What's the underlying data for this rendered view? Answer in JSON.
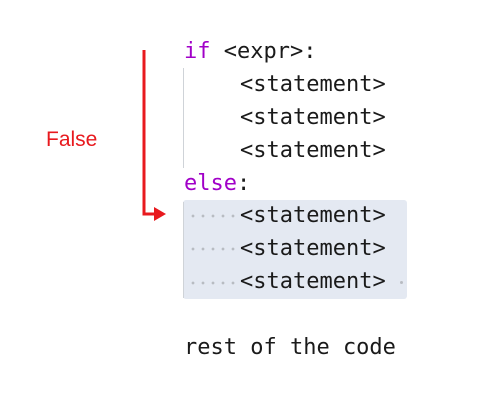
{
  "flow": {
    "condition_label": "False",
    "arrow_color": "#e8191e"
  },
  "code": {
    "if_keyword": "if",
    "if_condition": " <expr>:",
    "if_body": [
      "<statement>",
      "<statement>",
      "<statement>"
    ],
    "else_keyword": "else",
    "else_colon": ":",
    "else_body": [
      "<statement>",
      "<statement>",
      "<statement>"
    ],
    "after": "rest of the code"
  },
  "colors": {
    "keyword": "#a100c8",
    "text": "#1a1a1a",
    "highlight": "#e4e9f2"
  }
}
